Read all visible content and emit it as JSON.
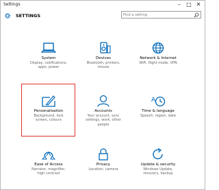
{
  "window": {
    "title": "Settings"
  },
  "header": {
    "title": "SETTINGS"
  },
  "search": {
    "placeholder": "Find a setting"
  },
  "accent_color": "#0067b8",
  "highlight_color": "#e0302a",
  "tiles": [
    {
      "name": "System",
      "desc1": "Display, notifications,",
      "desc2": "apps, power",
      "desc3": "",
      "icon": "laptop-icon"
    },
    {
      "name": "Devices",
      "desc1": "Bluetooth, printers,",
      "desc2": "mouse",
      "desc3": "",
      "icon": "devices-icon"
    },
    {
      "name": "Network & Internet",
      "desc1": "WiFi, flight mode, VPN",
      "desc2": "",
      "desc3": "",
      "icon": "globe-icon"
    },
    {
      "name": "Personalisation",
      "desc1": "Background, lock",
      "desc2": "screen, colours",
      "desc3": "",
      "icon": "personalisation-icon"
    },
    {
      "name": "Accounts",
      "desc1": "Your account, sync",
      "desc2": "settings, work, other",
      "desc3": "people",
      "icon": "person-icon"
    },
    {
      "name": "Time & language",
      "desc1": "Speech, region, date",
      "desc2": "",
      "desc3": "",
      "icon": "time-language-icon"
    },
    {
      "name": "Ease of Access",
      "desc1": "Narrator, magnifier,",
      "desc2": "high contrast",
      "desc3": "",
      "icon": "ease-of-access-icon"
    },
    {
      "name": "Privacy",
      "desc1": "Location, camera",
      "desc2": "",
      "desc3": "",
      "icon": "lock-icon"
    },
    {
      "name": "Update & security",
      "desc1": "Windows Update,",
      "desc2": "recovery, backup",
      "desc3": "",
      "icon": "update-icon"
    }
  ]
}
